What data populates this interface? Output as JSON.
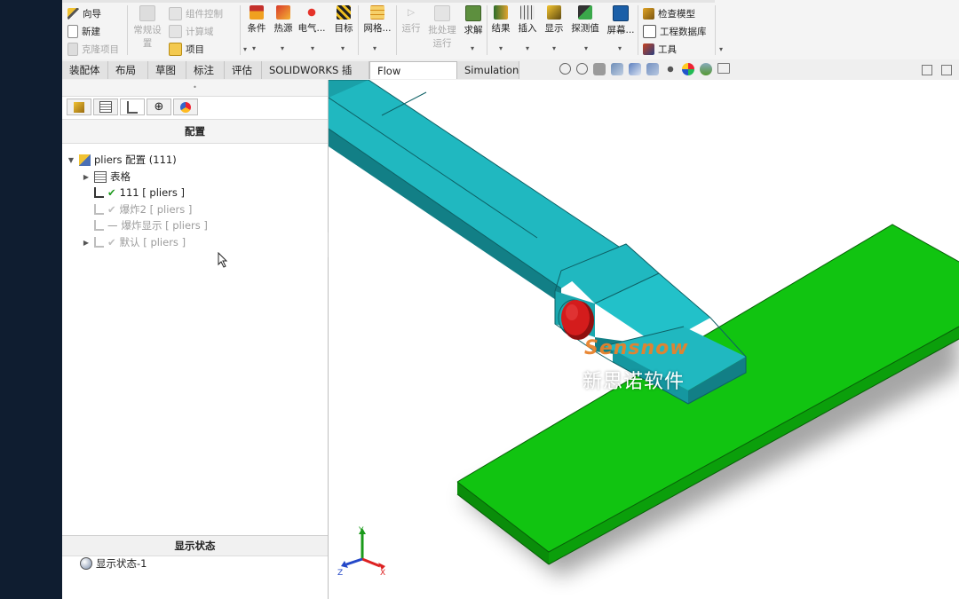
{
  "ribbon": {
    "group1": [
      {
        "label": "向导",
        "disabled": false
      },
      {
        "label": "新建",
        "disabled": false
      },
      {
        "label": "克隆项目",
        "disabled": true
      }
    ],
    "group2_big": {
      "label_line1": "常规设",
      "label_line2": "置"
    },
    "group2_small": [
      {
        "label": "组件控制"
      },
      {
        "label": "计算域"
      },
      {
        "label": "项目"
      }
    ],
    "group3": [
      {
        "label": "条件"
      },
      {
        "label": "热源"
      },
      {
        "label": "电气..."
      },
      {
        "label": "目标"
      }
    ],
    "group4": [
      {
        "label": "网格..."
      }
    ],
    "group5": [
      {
        "label": "运行",
        "label2": ""
      },
      {
        "label": "批处理",
        "label2": "运行"
      },
      {
        "label": "求解",
        "label2": ""
      }
    ],
    "group6": [
      {
        "label": "结果"
      },
      {
        "label": "插入"
      },
      {
        "label": "显示"
      },
      {
        "label": "探测值"
      },
      {
        "label": "屏幕..."
      }
    ],
    "group7": [
      {
        "label": "检查模型"
      },
      {
        "label": "工程数据库"
      },
      {
        "label": "工具"
      }
    ]
  },
  "tabs": [
    {
      "label": "装配体"
    },
    {
      "label": "布局"
    },
    {
      "label": "草图"
    },
    {
      "label": "标注"
    },
    {
      "label": "评估"
    },
    {
      "label": "SOLIDWORKS 插件"
    },
    {
      "label": "Flow Simulation"
    },
    {
      "label": "Simulation"
    }
  ],
  "panel": {
    "title": "配置",
    "root": {
      "label": "pliers 配置  (111)"
    },
    "items": [
      {
        "label": "表格",
        "state": "table"
      },
      {
        "label": "111 [ pliers ]",
        "state": "active"
      },
      {
        "label": "爆炸2 [ pliers ]",
        "state": "inactive"
      },
      {
        "label": "爆炸显示 [ pliers ]",
        "state": "inactive-dash"
      },
      {
        "label": "默认 [ pliers ]",
        "state": "inactive"
      }
    ],
    "display_state_title": "显示状态",
    "display_state_item": "显示状态-1"
  },
  "watermark": {
    "line1": "Sensnow",
    "line2": "新思诺软件"
  },
  "triad": {
    "x": "X",
    "y": "Y",
    "z": "Z"
  },
  "colors": {
    "arm": "#20b8c0",
    "arm_dark": "#127f86",
    "plate": "#11c411",
    "plate_dark": "#0a8d0a",
    "pin": "#d41c1c",
    "watermark": "#e8822c"
  }
}
